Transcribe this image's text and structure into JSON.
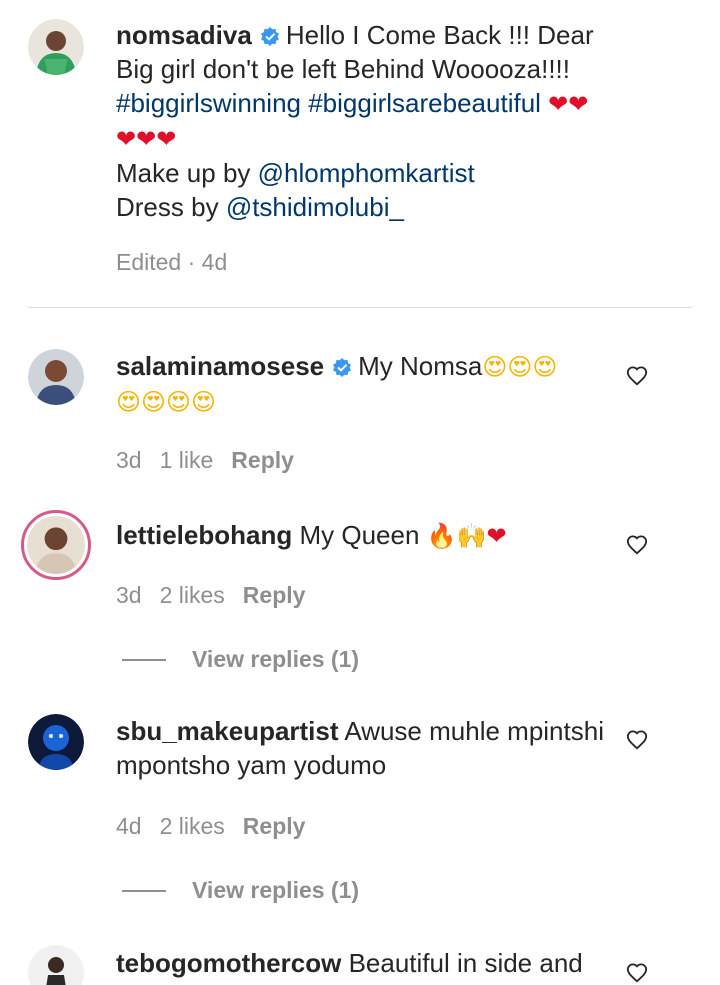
{
  "post": {
    "username": "nomsadiva",
    "verified": true,
    "caption_text": "Hello I Come Back !!! Dear Big girl don't be left Behind Wooooza!!!!",
    "hashtags": "#biggirlswinning #biggirlsarebeautiful",
    "hearts_line": "❤❤",
    "hearts_line2": "❤❤❤",
    "makeup_prefix": "Make up by",
    "makeup_handle": "@hlomphomkartist",
    "dress_prefix": "Dress by",
    "dress_handle": "@tshidimolubi_",
    "meta": "Edited · 4d"
  },
  "comments": [
    {
      "username": "salaminamosese",
      "verified": true,
      "text": "My Nomsa",
      "emoji_1": "😍😍😍",
      "emoji_2": "😍😍😍😍",
      "time": "3d",
      "likes": "1 like",
      "reply": "Reply"
    },
    {
      "username": "lettielebohang",
      "verified": false,
      "text": "My Queen",
      "emoji_fire": "🔥",
      "emoji_hands": "🙌",
      "emoji_heart": "❤",
      "time": "3d",
      "likes": "2 likes",
      "reply": "Reply",
      "view_replies": "View replies (1)"
    },
    {
      "username": "sbu_makeupartist",
      "verified": false,
      "text": "Awuse muhle mpintshi mpontsho yam yodumo",
      "time": "4d",
      "likes": "2 likes",
      "reply": "Reply",
      "view_replies": "View replies (1)"
    },
    {
      "username": "tebogomothercow",
      "verified": false,
      "text": "Beautiful in side and"
    }
  ],
  "icons": {
    "like": "heart-outline-icon",
    "verified": "verified-badge-icon"
  },
  "colors": {
    "text": "#262626",
    "link": "#00376b",
    "muted": "#8e8e8e",
    "verified": "#3897f0",
    "story_ring": "#d65a88"
  }
}
